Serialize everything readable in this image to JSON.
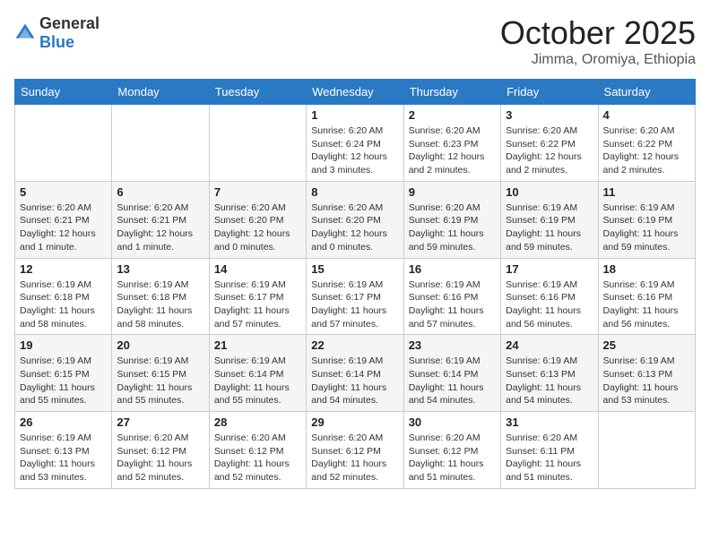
{
  "header": {
    "logo_general": "General",
    "logo_blue": "Blue",
    "month": "October 2025",
    "location": "Jimma, Oromiya, Ethiopia"
  },
  "weekdays": [
    "Sunday",
    "Monday",
    "Tuesday",
    "Wednesday",
    "Thursday",
    "Friday",
    "Saturday"
  ],
  "weeks": [
    [
      {
        "day": "",
        "info": ""
      },
      {
        "day": "",
        "info": ""
      },
      {
        "day": "",
        "info": ""
      },
      {
        "day": "1",
        "info": "Sunrise: 6:20 AM\nSunset: 6:24 PM\nDaylight: 12 hours and 3 minutes."
      },
      {
        "day": "2",
        "info": "Sunrise: 6:20 AM\nSunset: 6:23 PM\nDaylight: 12 hours and 2 minutes."
      },
      {
        "day": "3",
        "info": "Sunrise: 6:20 AM\nSunset: 6:22 PM\nDaylight: 12 hours and 2 minutes."
      },
      {
        "day": "4",
        "info": "Sunrise: 6:20 AM\nSunset: 6:22 PM\nDaylight: 12 hours and 2 minutes."
      }
    ],
    [
      {
        "day": "5",
        "info": "Sunrise: 6:20 AM\nSunset: 6:21 PM\nDaylight: 12 hours and 1 minute."
      },
      {
        "day": "6",
        "info": "Sunrise: 6:20 AM\nSunset: 6:21 PM\nDaylight: 12 hours and 1 minute."
      },
      {
        "day": "7",
        "info": "Sunrise: 6:20 AM\nSunset: 6:20 PM\nDaylight: 12 hours and 0 minutes."
      },
      {
        "day": "8",
        "info": "Sunrise: 6:20 AM\nSunset: 6:20 PM\nDaylight: 12 hours and 0 minutes."
      },
      {
        "day": "9",
        "info": "Sunrise: 6:20 AM\nSunset: 6:19 PM\nDaylight: 11 hours and 59 minutes."
      },
      {
        "day": "10",
        "info": "Sunrise: 6:19 AM\nSunset: 6:19 PM\nDaylight: 11 hours and 59 minutes."
      },
      {
        "day": "11",
        "info": "Sunrise: 6:19 AM\nSunset: 6:19 PM\nDaylight: 11 hours and 59 minutes."
      }
    ],
    [
      {
        "day": "12",
        "info": "Sunrise: 6:19 AM\nSunset: 6:18 PM\nDaylight: 11 hours and 58 minutes."
      },
      {
        "day": "13",
        "info": "Sunrise: 6:19 AM\nSunset: 6:18 PM\nDaylight: 11 hours and 58 minutes."
      },
      {
        "day": "14",
        "info": "Sunrise: 6:19 AM\nSunset: 6:17 PM\nDaylight: 11 hours and 57 minutes."
      },
      {
        "day": "15",
        "info": "Sunrise: 6:19 AM\nSunset: 6:17 PM\nDaylight: 11 hours and 57 minutes."
      },
      {
        "day": "16",
        "info": "Sunrise: 6:19 AM\nSunset: 6:16 PM\nDaylight: 11 hours and 57 minutes."
      },
      {
        "day": "17",
        "info": "Sunrise: 6:19 AM\nSunset: 6:16 PM\nDaylight: 11 hours and 56 minutes."
      },
      {
        "day": "18",
        "info": "Sunrise: 6:19 AM\nSunset: 6:16 PM\nDaylight: 11 hours and 56 minutes."
      }
    ],
    [
      {
        "day": "19",
        "info": "Sunrise: 6:19 AM\nSunset: 6:15 PM\nDaylight: 11 hours and 55 minutes."
      },
      {
        "day": "20",
        "info": "Sunrise: 6:19 AM\nSunset: 6:15 PM\nDaylight: 11 hours and 55 minutes."
      },
      {
        "day": "21",
        "info": "Sunrise: 6:19 AM\nSunset: 6:14 PM\nDaylight: 11 hours and 55 minutes."
      },
      {
        "day": "22",
        "info": "Sunrise: 6:19 AM\nSunset: 6:14 PM\nDaylight: 11 hours and 54 minutes."
      },
      {
        "day": "23",
        "info": "Sunrise: 6:19 AM\nSunset: 6:14 PM\nDaylight: 11 hours and 54 minutes."
      },
      {
        "day": "24",
        "info": "Sunrise: 6:19 AM\nSunset: 6:13 PM\nDaylight: 11 hours and 54 minutes."
      },
      {
        "day": "25",
        "info": "Sunrise: 6:19 AM\nSunset: 6:13 PM\nDaylight: 11 hours and 53 minutes."
      }
    ],
    [
      {
        "day": "26",
        "info": "Sunrise: 6:19 AM\nSunset: 6:13 PM\nDaylight: 11 hours and 53 minutes."
      },
      {
        "day": "27",
        "info": "Sunrise: 6:20 AM\nSunset: 6:12 PM\nDaylight: 11 hours and 52 minutes."
      },
      {
        "day": "28",
        "info": "Sunrise: 6:20 AM\nSunset: 6:12 PM\nDaylight: 11 hours and 52 minutes."
      },
      {
        "day": "29",
        "info": "Sunrise: 6:20 AM\nSunset: 6:12 PM\nDaylight: 11 hours and 52 minutes."
      },
      {
        "day": "30",
        "info": "Sunrise: 6:20 AM\nSunset: 6:12 PM\nDaylight: 11 hours and 51 minutes."
      },
      {
        "day": "31",
        "info": "Sunrise: 6:20 AM\nSunset: 6:11 PM\nDaylight: 11 hours and 51 minutes."
      },
      {
        "day": "",
        "info": ""
      }
    ]
  ]
}
